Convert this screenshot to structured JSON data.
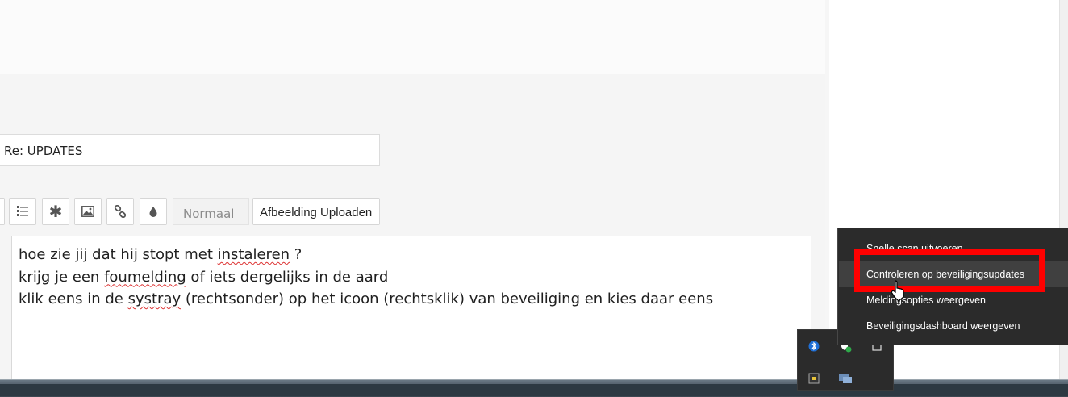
{
  "subject": {
    "value": "Re: UPDATES"
  },
  "toolbar": {
    "format_value": "Normaal",
    "upload_label": "Afbeelding Uploaden",
    "icons": [
      "list-icon",
      "numbered-list-icon",
      "asterisk-icon",
      "image-icon",
      "link-icon",
      "color-drop-icon"
    ]
  },
  "editor": {
    "lines": [
      {
        "before": "hoe zie jij dat hij stopt met ",
        "misspelled": "instaleren",
        "after": " ?"
      },
      {
        "before": "krijg je een ",
        "misspelled": "foumelding",
        "after": " of iets dergelijks in de aard"
      },
      {
        "before": "klik eens in de ",
        "misspelled": "systray",
        "after": " (rechtsonder) op het icoon (rechtsklik) van beveiliging en kies daar eens"
      }
    ]
  },
  "context_menu": {
    "items": [
      "Snelle scan uitvoeren",
      "Controleren op beveiligingsupdates",
      "Meldingsopties weergeven",
      "Beveiligingsdashboard weergeven"
    ]
  },
  "colors": {
    "highlight": "#ff0000",
    "menu_bg": "#2b2b2b",
    "taskbar": "#3c4650"
  }
}
